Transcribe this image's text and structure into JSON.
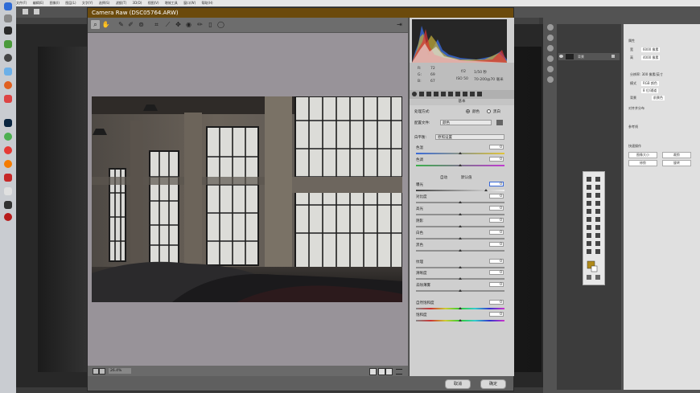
{
  "menubar": {
    "items": [
      "文件(F)",
      "编辑(E)",
      "图像(I)",
      "图层(L)",
      "文字(Y)",
      "选择(S)",
      "滤镜(T)",
      "3D(D)",
      "视图(V)",
      "增效工具",
      "窗口(W)",
      "帮助(H)"
    ]
  },
  "dialog": {
    "title": "Camera Raw (DSC05764.ARW)",
    "zoom": "26.4%",
    "cancel_label": "取消",
    "ok_label": "确定"
  },
  "readout": {
    "r_label": "R:",
    "g_label": "G:",
    "b_label": "B:",
    "r": "72",
    "g": "69",
    "b": "67",
    "aperture": "f/2",
    "shutter": "1/50 秒",
    "iso": "ISO 50",
    "lens": "70-200@70 毫米"
  },
  "panel": {
    "header": "基本",
    "treatment_label": "处理方式:",
    "color_option": "颜色",
    "bw_option": "黑白",
    "profile_label": "配置文件:",
    "profile_value": "颜色",
    "wb_label": "白平衡:",
    "wb_value": "原照设置",
    "temp_label": "色温",
    "temp_value": "0",
    "tint_label": "色调",
    "tint_value": "0",
    "auto_label": "自动",
    "default_label": "默认值",
    "exposure_label": "曝光",
    "exposure_value": "0",
    "contrast_label": "对比度",
    "contrast_value": "0",
    "highlights_label": "高光",
    "highlights_value": "0",
    "shadows_label": "阴影",
    "shadows_value": "0",
    "whites_label": "白色",
    "whites_value": "0",
    "blacks_label": "黑色",
    "blacks_value": "0",
    "clarity_label": "纹理",
    "clarity_value": "0",
    "texture_label": "清晰度",
    "texture_value": "0",
    "dehaze_label": "去除薄雾",
    "dehaze_value": "0",
    "vibrance_label": "自然饱和度",
    "vibrance_value": "0",
    "saturation_label": "饱和度",
    "saturation_value": "0"
  },
  "props": {
    "title": "属性",
    "width_label": "宽",
    "width_value": "6000 像素",
    "height_label": "高",
    "height_value": "4000 像素",
    "resolution": "分辨率: 300 像素/英寸",
    "mode_label": "模式",
    "mode_value": "RGB 颜色",
    "depth_value": "8 位/通道",
    "fill_label": "背景",
    "fill_value": "前景色",
    "align_title": "对齐并分布",
    "guides_title": "参考线",
    "quick_title": "快速操作",
    "quick_btn1": "图像大小",
    "quick_btn2": "裁剪",
    "quick_btn3": "修剪",
    "quick_btn4": "旋转"
  },
  "layers": {
    "layer_name": "背景"
  },
  "colors": {
    "title_bar": "#6b4a0c",
    "panel_bg": "#cfcfcf",
    "canvas_bg": "#989399",
    "accent": "#b08a1a"
  }
}
